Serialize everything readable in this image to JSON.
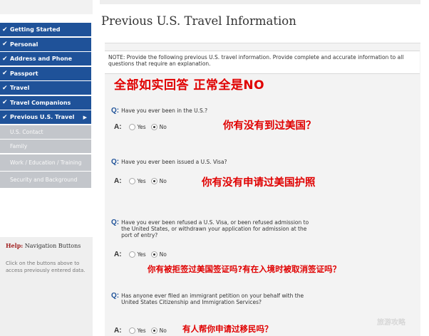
{
  "sidebar": {
    "items": [
      {
        "label": "Getting Started"
      },
      {
        "label": "Personal"
      },
      {
        "label": "Address and Phone"
      },
      {
        "label": "Passport"
      },
      {
        "label": "Travel"
      },
      {
        "label": "Travel Companions"
      },
      {
        "label": "Previous U.S. Travel"
      },
      {
        "label": "U.S. Contact"
      },
      {
        "label": "Family"
      },
      {
        "label": "Work / Education / Training"
      },
      {
        "label": "Security and Background"
      }
    ]
  },
  "help": {
    "title_prefix": "Help:",
    "title_rest": " Navigation Buttons",
    "text": "Click on the buttons above to access previously entered data."
  },
  "main": {
    "title": "Previous U.S. Travel Information",
    "note": "NOTE: Provide the following previous U.S. travel information. Provide complete and accurate information to all questions that require an explanation."
  },
  "annotations": {
    "header": "全部如实回答  正常全是NO",
    "q1": "你有没有到过美国？",
    "q2": "你有没有申请过美国护照",
    "q3": "你有被拒签过美国签证吗?有在入境时被取消签证吗？",
    "q4": "有人帮你申请过移民吗？"
  },
  "labels": {
    "q": "Q:",
    "a": "A:",
    "yes": "Yes",
    "no": "No"
  },
  "questions": [
    {
      "text": "Have you ever been in the U.S.?",
      "answer": "No"
    },
    {
      "text": "Have you ever been issued a U.S. Visa?",
      "answer": "No"
    },
    {
      "text": "Have you ever been refused a U.S. Visa, or been refused admission to the United States, or withdrawn your application for admission at the port of entry?",
      "answer": "No"
    },
    {
      "text": "Has anyone ever filed an immigrant petition on your behalf with the United States Citizenship and Immigration Services?",
      "answer": "No"
    }
  ],
  "watermark": "旅游攻略",
  "colors": {
    "nav_active": "#1f5299",
    "nav_pending": "#c3c6cb",
    "annotation": "#e00000",
    "help_accent": "#a02020"
  }
}
